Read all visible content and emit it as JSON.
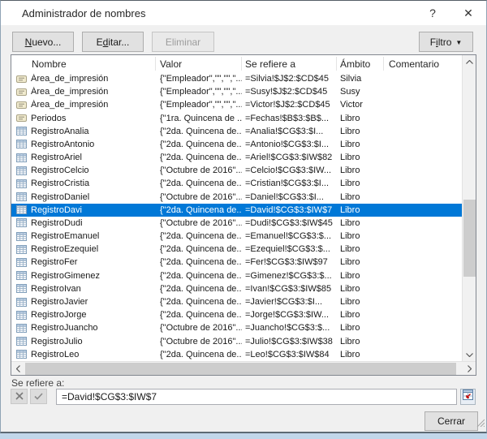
{
  "window": {
    "title": "Administrador de nombres",
    "help_glyph": "?",
    "close_glyph": "✕"
  },
  "toolbar": {
    "new": {
      "before": "",
      "key": "N",
      "after": "uevo..."
    },
    "edit": {
      "before": "E",
      "key": "d",
      "after": "itar..."
    },
    "delete": {
      "label": "Eliminar"
    },
    "filter": {
      "before": "F",
      "key": "i",
      "after": "ltro",
      "arrow": "▼"
    }
  },
  "table": {
    "columns": [
      "Nombre",
      "Valor",
      "Se refiere a",
      "Ámbito",
      "Comentario"
    ],
    "rows": [
      {
        "icon": "defined-name",
        "name": "Área_de_impresión",
        "value": "{\"Empleador\",\"\",\"\",\"...",
        "refers": "=Silvia!$J$2:$CD$45",
        "scope": "Silvia",
        "comment": "",
        "selected": false
      },
      {
        "icon": "defined-name",
        "name": "Área_de_impresión",
        "value": "{\"Empleador\",\"\",\"\",\"...",
        "refers": "=Susy!$J$2:$CD$45",
        "scope": "Susy",
        "comment": "",
        "selected": false
      },
      {
        "icon": "defined-name",
        "name": "Área_de_impresión",
        "value": "{\"Empleador\",\"\",\"\",\"...",
        "refers": "=Victor!$J$2:$CD$45",
        "scope": "Victor",
        "comment": "",
        "selected": false
      },
      {
        "icon": "defined-name",
        "name": "Periodos",
        "value": "{\"1ra. Quincena de ...",
        "refers": "=Fechas!$B$3:$B$...",
        "scope": "Libro",
        "comment": "",
        "selected": false
      },
      {
        "icon": "table",
        "name": "RegistroAnalia",
        "value": "{\"2da. Quincena de...",
        "refers": "=Analia!$CG$3:$I...",
        "scope": "Libro",
        "comment": "",
        "selected": false
      },
      {
        "icon": "table",
        "name": "RegistroAntonio",
        "value": "{\"2da. Quincena de...",
        "refers": "=Antonio!$CG$3:$I...",
        "scope": "Libro",
        "comment": "",
        "selected": false
      },
      {
        "icon": "table",
        "name": "RegistroAriel",
        "value": "{\"2da. Quincena de...",
        "refers": "=Ariel!$CG$3:$IW$82",
        "scope": "Libro",
        "comment": "",
        "selected": false
      },
      {
        "icon": "table",
        "name": "RegistroCelcio",
        "value": "{\"Octubre de 2016\"...",
        "refers": "=Celcio!$CG$3:$IW...",
        "scope": "Libro",
        "comment": "",
        "selected": false
      },
      {
        "icon": "table",
        "name": "RegistroCristia",
        "value": "{\"2da. Quincena de...",
        "refers": "=Cristian!$CG$3:$I...",
        "scope": "Libro",
        "comment": "",
        "selected": false
      },
      {
        "icon": "table",
        "name": "RegistroDaniel",
        "value": "{\"Octubre de 2016\"...",
        "refers": "=Daniel!$CG$3:$I...",
        "scope": "Libro",
        "comment": "",
        "selected": false
      },
      {
        "icon": "table",
        "name": "RegistroDavi",
        "value": "{\"2da. Quincena de...",
        "refers": "=David!$CG$3:$IW$7",
        "scope": "Libro",
        "comment": "",
        "selected": true
      },
      {
        "icon": "table",
        "name": "RegistroDudi",
        "value": "{\"Octubre de 2016\"...",
        "refers": "=Dudi!$CG$3:$IW$45",
        "scope": "Libro",
        "comment": "",
        "selected": false
      },
      {
        "icon": "table",
        "name": "RegistroEmanuel",
        "value": "{\"2da. Quincena de...",
        "refers": "=Emanuel!$CG$3:$...",
        "scope": "Libro",
        "comment": "",
        "selected": false
      },
      {
        "icon": "table",
        "name": "RegistroEzequiel",
        "value": "{\"2da. Quincena de...",
        "refers": "=Ezequiel!$CG$3:$...",
        "scope": "Libro",
        "comment": "",
        "selected": false
      },
      {
        "icon": "table",
        "name": "RegistroFer",
        "value": "{\"2da. Quincena de...",
        "refers": "=Fer!$CG$3:$IW$97",
        "scope": "Libro",
        "comment": "",
        "selected": false
      },
      {
        "icon": "table",
        "name": "RegistroGimenez",
        "value": "{\"2da. Quincena de...",
        "refers": "=Gimenez!$CG$3:$...",
        "scope": "Libro",
        "comment": "",
        "selected": false
      },
      {
        "icon": "table",
        "name": "RegistroIvan",
        "value": "{\"2da. Quincena de...",
        "refers": "=Ivan!$CG$3:$IW$85",
        "scope": "Libro",
        "comment": "",
        "selected": false
      },
      {
        "icon": "table",
        "name": "RegistroJavier",
        "value": "{\"2da. Quincena de...",
        "refers": "=Javier!$CG$3:$I...",
        "scope": "Libro",
        "comment": "",
        "selected": false
      },
      {
        "icon": "table",
        "name": "RegistroJorge",
        "value": "{\"2da. Quincena de...",
        "refers": "=Jorge!$CG$3:$IW...",
        "scope": "Libro",
        "comment": "",
        "selected": false
      },
      {
        "icon": "table",
        "name": "RegistroJuancho",
        "value": "{\"Octubre de 2016\"...",
        "refers": "=Juancho!$CG$3:$...",
        "scope": "Libro",
        "comment": "",
        "selected": false
      },
      {
        "icon": "table",
        "name": "RegistroJulio",
        "value": "{\"Octubre de 2016\"...",
        "refers": "=Julio!$CG$3:$IW$38",
        "scope": "Libro",
        "comment": "",
        "selected": false
      },
      {
        "icon": "table",
        "name": "RegistroLeo",
        "value": "{\"2da. Quincena de...",
        "refers": "=Leo!$CG$3:$IW$84",
        "scope": "Libro",
        "comment": "",
        "selected": false
      }
    ]
  },
  "refers_section": {
    "label": "Se refiere a:",
    "formula": "=David!$CG$3:$IW$7"
  },
  "footer": {
    "close_label": "Cerrar"
  },
  "colors": {
    "selection": "#0078d7",
    "selection_text": "#ffffff"
  }
}
